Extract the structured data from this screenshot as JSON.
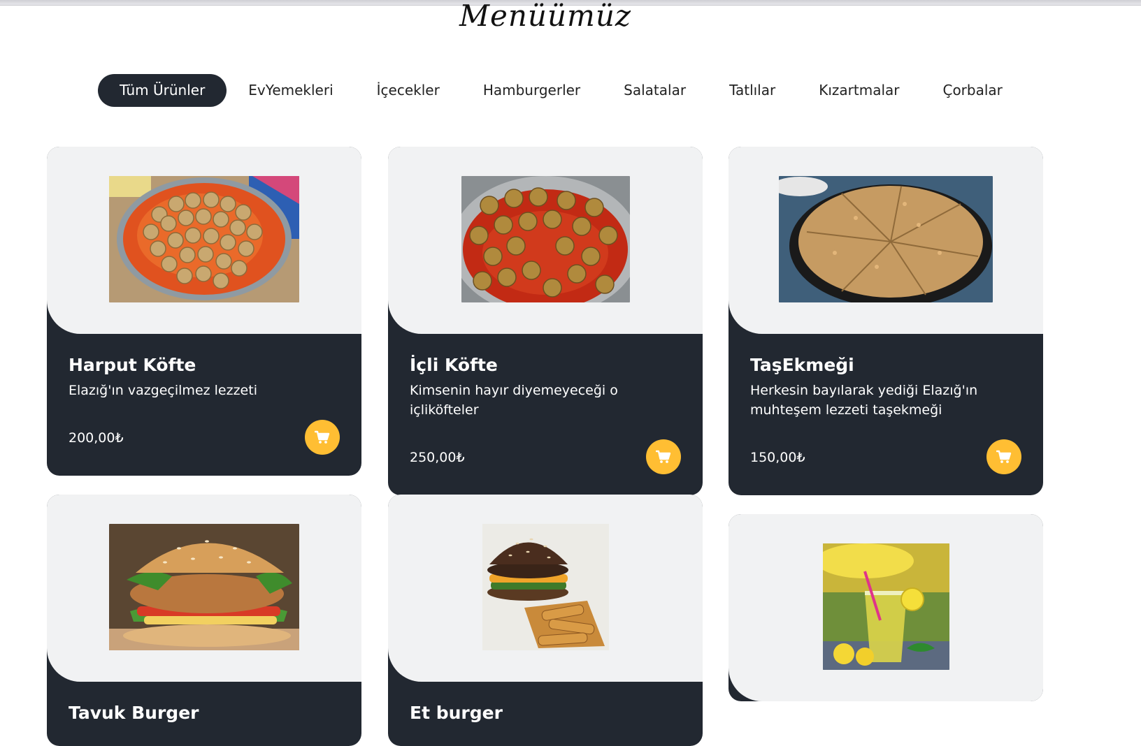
{
  "page": {
    "heading": "Menüümüz"
  },
  "filters": [
    {
      "label": "Tüm Ürünler",
      "active": true
    },
    {
      "label": "EvYemekleri",
      "active": false
    },
    {
      "label": "İçecekler",
      "active": false
    },
    {
      "label": "Hamburgerler",
      "active": false
    },
    {
      "label": "Salatalar",
      "active": false
    },
    {
      "label": "Tatlılar",
      "active": false
    },
    {
      "label": "Kızartmalar",
      "active": false
    },
    {
      "label": "Çorbalar",
      "active": false
    }
  ],
  "products": [
    {
      "name": "Harput Köfte",
      "description": "Elazığ'ın vazgeçilmez lezzeti",
      "price": "200,00₺",
      "image": "harput-kofte-photo"
    },
    {
      "name": "İçli Köfte",
      "description": "Kimsenin hayır diyemeyeceği o içliköfteler",
      "price": "250,00₺",
      "image": "icli-kofte-photo"
    },
    {
      "name": "TaşEkmeği",
      "description": "Herkesin bayılarak yediği Elazığ'ın muhteşem lezzeti taşekmeği",
      "price": "150,00₺",
      "image": "tasekmegi-photo"
    },
    {
      "name": "Tavuk Burger",
      "description": "",
      "price": "",
      "image": "tavuk-burger-photo"
    },
    {
      "name": "Et burger",
      "description": "",
      "price": "",
      "image": "et-burger-photo"
    },
    {
      "name": "",
      "description": "",
      "price": "",
      "image": "lemonade-photo"
    }
  ],
  "colors": {
    "dark": "#222831",
    "accent": "#ffbe33",
    "card_top": "#f1f2f3"
  },
  "icons": {
    "cart": "shopping-cart-icon"
  }
}
